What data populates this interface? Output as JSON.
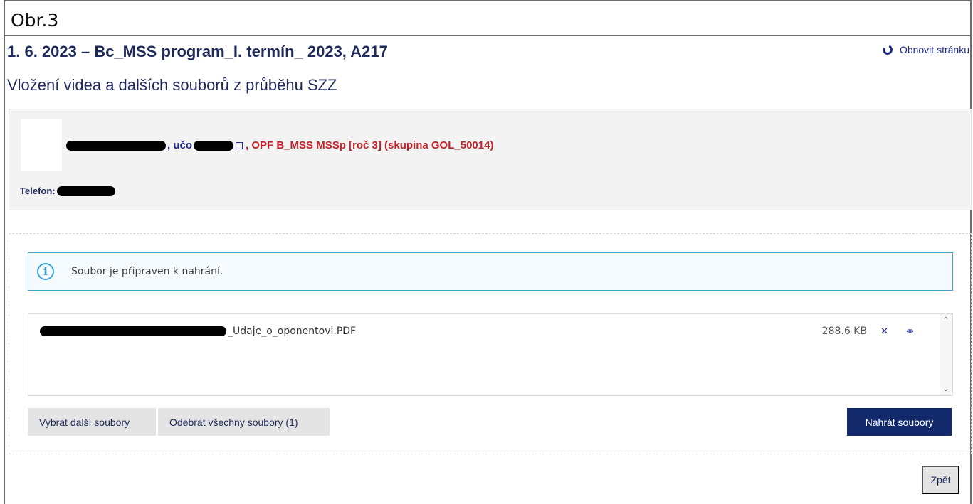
{
  "figure_label": "Obr.3",
  "header": {
    "title": "1. 6. 2023 – Bc_MSS program_I. termín_ 2023, A217",
    "refresh_label": "Obnovit stránku",
    "subtitle": "Vložení videa a dalších souborů z průběhu SZZ"
  },
  "person": {
    "uco_label": ", učo",
    "study_info": ", OPF B_MSS MSSp [roč 3] (skupina GOL_50014)",
    "phone_label": "Telefon:"
  },
  "upload": {
    "info_message": "Soubor je připraven k nahrání.",
    "files": [
      {
        "name_suffix": "_Udaje_o_oponentovi.PDF",
        "size": "288.6 KB"
      }
    ],
    "select_more_label": "Vybrat další soubory",
    "remove_all_label": "Odebrat všechny soubory (1)",
    "upload_label": "Nahrát soubory"
  },
  "footer": {
    "back_label": "Zpět"
  },
  "icons": {
    "refresh": "refresh-icon",
    "external_link": "external-link-icon",
    "info": "info-icon",
    "remove": "remove-icon",
    "move": "move-icon"
  },
  "colors": {
    "primary_dark": "#12296b",
    "text_red": "#c0242a",
    "info_border": "#3aa3d1"
  }
}
